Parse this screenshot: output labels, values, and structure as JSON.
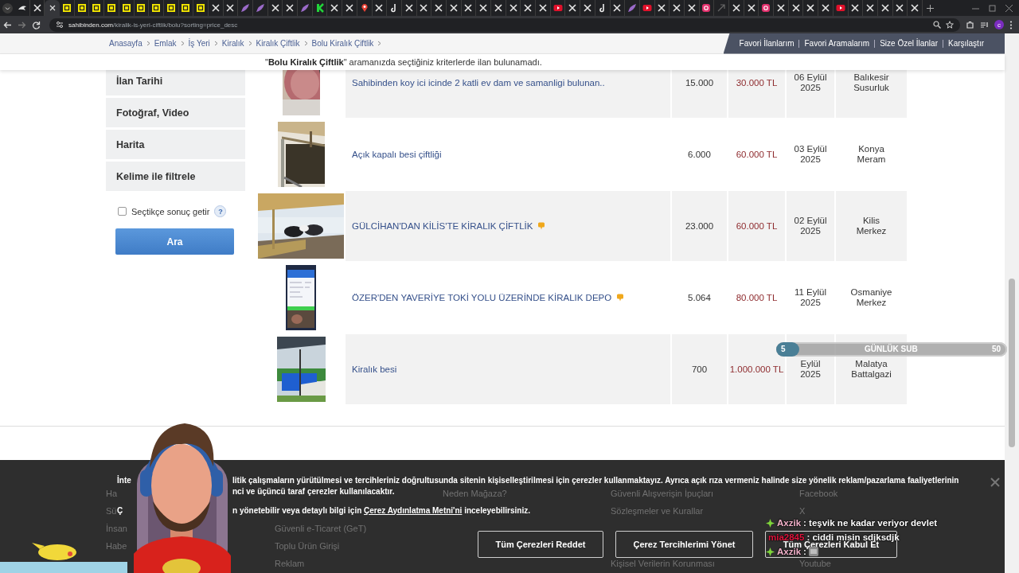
{
  "browser": {
    "tabs": [
      {
        "kind": "bird",
        "selected": false
      },
      {
        "kind": "x",
        "selected": false
      },
      {
        "kind": "blank",
        "selected": true
      },
      {
        "kind": "s",
        "selected": false
      },
      {
        "kind": "s",
        "selected": false
      },
      {
        "kind": "s",
        "selected": false
      },
      {
        "kind": "s",
        "selected": false
      },
      {
        "kind": "s",
        "selected": false
      },
      {
        "kind": "s",
        "selected": false
      },
      {
        "kind": "s",
        "selected": false
      },
      {
        "kind": "s",
        "selected": false
      },
      {
        "kind": "s",
        "selected": false
      },
      {
        "kind": "s",
        "selected": false
      },
      {
        "kind": "x",
        "selected": false
      },
      {
        "kind": "x",
        "selected": false
      },
      {
        "kind": "feather",
        "selected": false
      },
      {
        "kind": "feather",
        "selected": false
      },
      {
        "kind": "x",
        "selected": false
      },
      {
        "kind": "x",
        "selected": false
      },
      {
        "kind": "feather",
        "selected": false
      },
      {
        "kind": "k",
        "selected": false
      },
      {
        "kind": "x",
        "selected": false
      },
      {
        "kind": "x",
        "selected": false
      },
      {
        "kind": "maps",
        "selected": false
      },
      {
        "kind": "x",
        "selected": false
      },
      {
        "kind": "tiktok",
        "selected": false
      },
      {
        "kind": "x",
        "selected": false
      },
      {
        "kind": "x",
        "selected": false
      },
      {
        "kind": "x",
        "selected": false
      },
      {
        "kind": "x",
        "selected": false
      },
      {
        "kind": "x",
        "selected": false
      },
      {
        "kind": "x",
        "selected": false
      },
      {
        "kind": "x",
        "selected": false
      },
      {
        "kind": "x",
        "selected": false
      },
      {
        "kind": "x",
        "selected": false
      },
      {
        "kind": "x",
        "selected": false
      },
      {
        "kind": "youtube",
        "selected": false
      },
      {
        "kind": "x",
        "selected": false
      },
      {
        "kind": "x",
        "selected": false
      },
      {
        "kind": "tiktok",
        "selected": false
      },
      {
        "kind": "x",
        "selected": false
      },
      {
        "kind": "feather",
        "selected": false
      },
      {
        "kind": "youtube",
        "selected": false
      },
      {
        "kind": "x",
        "selected": false
      },
      {
        "kind": "x",
        "selected": false
      },
      {
        "kind": "x",
        "selected": false
      },
      {
        "kind": "instagram",
        "selected": false
      },
      {
        "kind": "dim",
        "selected": false
      },
      {
        "kind": "x",
        "selected": false
      },
      {
        "kind": "x",
        "selected": false
      },
      {
        "kind": "instagram",
        "selected": false
      },
      {
        "kind": "x",
        "selected": false
      },
      {
        "kind": "x",
        "selected": false
      },
      {
        "kind": "x",
        "selected": false
      },
      {
        "kind": "x",
        "selected": false
      },
      {
        "kind": "youtube",
        "selected": false
      },
      {
        "kind": "x",
        "selected": false
      },
      {
        "kind": "x",
        "selected": false
      },
      {
        "kind": "x",
        "selected": false
      },
      {
        "kind": "x",
        "selected": false
      },
      {
        "kind": "x",
        "selected": false
      }
    ],
    "url": {
      "host": "sahibinden.com",
      "path": "/kiralik-is-yeri-ciftlik/bolu?sorting=price_desc"
    },
    "profile_initial": "c"
  },
  "header": {
    "breadcrumbs": [
      "Anasayfa",
      "Emlak",
      "İş Yeri",
      "Kiralık",
      "Kiralık Çiftlik",
      "Bolu Kiralık Çiftlik"
    ],
    "nav": [
      "Favori İlanlarım",
      "Favori Aramalarım",
      "Size Özel İlanlar",
      "Karşılaştır"
    ],
    "notice": "\"**Bolu Kiralık Çiftlik**\" aramanızda seçtiğiniz kriterlerde ilan bulunamadı."
  },
  "sidebar": {
    "filters": [
      "İlan Tarihi",
      "Fotoğraf, Video",
      "Harita",
      "Kelime ile filtrele"
    ],
    "instant": {
      "label": "Seçtikçe sonuç getir",
      "checked": false
    },
    "help": "?",
    "search_button": "Ara"
  },
  "listings": [
    {
      "title": "Sahibinden koy ici icinde 2 katli ev dam ve samanligi bulunan..",
      "promoted": false,
      "area": "15.000",
      "price": "30.000 TL",
      "date": "06 Eylül",
      "year": "2025",
      "city": "Balıkesir",
      "district": "Susurluk"
    },
    {
      "title": "Açık kapalı besi çiftliği",
      "promoted": false,
      "area": "6.000",
      "price": "60.000 TL",
      "date": "03 Eylül",
      "year": "2025",
      "city": "Konya",
      "district": "Meram"
    },
    {
      "title": "GÜLCİHAN'DAN KİLİS'TE KİRALIK ÇİFTLİK",
      "promoted": true,
      "area": "23.000",
      "price": "60.000 TL",
      "date": "02 Eylül",
      "year": "2025",
      "city": "Kilis",
      "district": "Merkez"
    },
    {
      "title": "ÖZER'DEN YAVERİYE TOKİ YOLU ÜZERİNDE KİRALIK DEPO",
      "promoted": true,
      "area": "5.064",
      "price": "80.000 TL",
      "date": "11 Eylül",
      "year": "2025",
      "city": "Osmaniye",
      "district": "Merkez"
    },
    {
      "title": "Kiralık besi",
      "promoted": false,
      "area": "700",
      "price": "1.000.000 TL",
      "date": "Eylül",
      "year": "2025",
      "city": "Malatya",
      "district": "Battalgazi"
    }
  ],
  "footer": {
    "columns": [
      {
        "items": [
          "Ha",
          "Sü",
          "İnsan",
          "Habe"
        ]
      },
      {
        "items": [
          "Güvenli e-Ticaret (GeT)",
          "Toplu Ürün Girişi",
          "Reklam"
        ]
      },
      {
        "items": [
          "Neden Mağaza?"
        ]
      },
      {
        "items": [
          "Güvenli Alışverişin İpuçları",
          "Sözleşmeler ve Kurallar",
          "Kişisel Verilerin Korunması"
        ]
      },
      {
        "items": [
          "Facebook",
          "X",
          "Youtube"
        ]
      }
    ]
  },
  "cookie": {
    "lines": [
      {
        "left": "İnte",
        "right": "litik çalışmaların yürütülmesi ve tercihleriniz doğrultusunda sitenin kişiselleştirilmesi için çerezler kullanmaktayız. Ayrıca açık rıza vermeniz halinde size yönelik reklam/pazarlama faaliyetlerinin"
      },
      {
        "right": "nci ve üçüncü taraf çerezler kullanılacaktır."
      },
      {
        "left": "Ç",
        "right": "n yönetebilir veya detaylı bilgi için",
        "link": "Çerez Aydınlatma Metni'ni",
        "after": "inceleyebilirsiniz."
      }
    ],
    "buttons": [
      "Tüm Çerezleri Reddet",
      "Çerez Tercihlerimi Yönet",
      "Tüm Çerezleri Kabul Et"
    ]
  },
  "stream": {
    "sub_goal": {
      "label": "GÜNLÜK SUB",
      "current": "5",
      "target": "50",
      "level": 0.1
    },
    "chat": [
      {
        "user": "Axzik",
        "color": "#f5b3cc",
        "text": ": teşvik ne kadar veriyor devlet",
        "badge": true,
        "emote": false
      },
      {
        "user": "mia2845",
        "color": "#e0143c",
        "text": ": ciddi misin sdjksdjk",
        "badge": false,
        "emote": false
      },
      {
        "user": "Axzik",
        "color": "#f5b3cc",
        "text": ":",
        "badge": true,
        "emote": true
      }
    ]
  }
}
